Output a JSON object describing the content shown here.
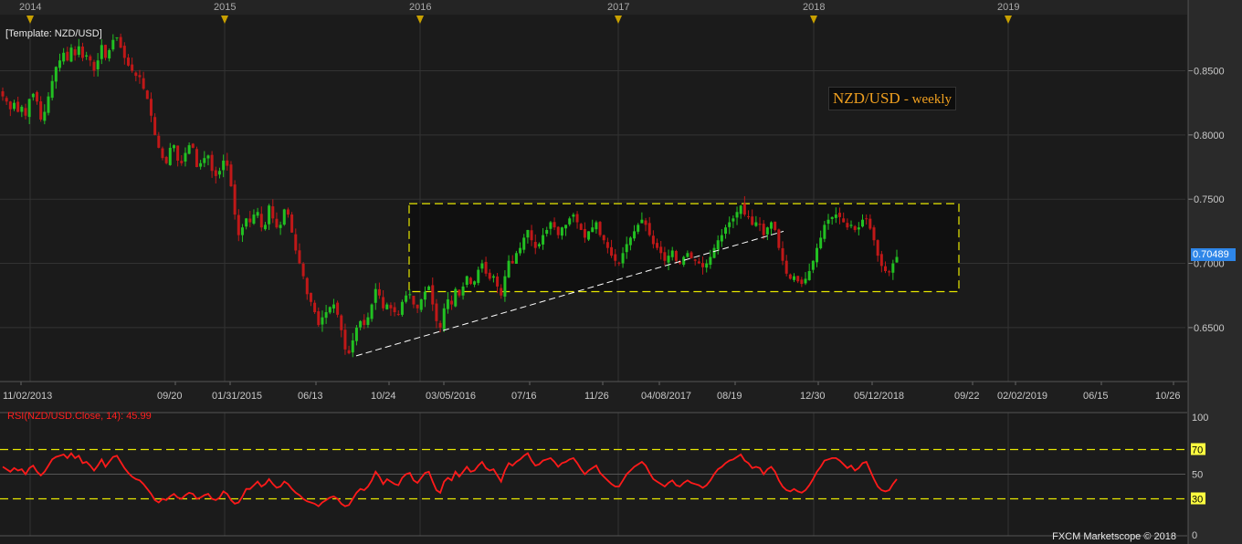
{
  "chart_data": {
    "type": "candlestick",
    "instrument_label": "[Template: NZD/USD]",
    "title": "NZD/USD",
    "subtitle": "- weekly",
    "current_price": "0.70489",
    "year_markers": [
      "2014",
      "2015",
      "2016",
      "2017",
      "2018",
      "2019"
    ],
    "x_tick_labels": [
      "11/02/2013",
      "09/20",
      "01/31/2015",
      "06/13",
      "10/24",
      "03/05/2016",
      "07/16",
      "11/26",
      "04/08/2017",
      "08/19",
      "12/30",
      "05/12/2018",
      "09/22",
      "02/02/2019",
      "06/15",
      "10/26"
    ],
    "y_tick_labels": [
      "0.8500",
      "0.8000",
      "0.7500",
      "0.7000",
      "0.6500"
    ],
    "ylim": [
      0.608,
      0.893
    ],
    "candle_closes": [
      0.83,
      0.826,
      0.82,
      0.825,
      0.818,
      0.822,
      0.815,
      0.828,
      0.832,
      0.826,
      0.812,
      0.818,
      0.83,
      0.842,
      0.853,
      0.858,
      0.864,
      0.858,
      0.868,
      0.862,
      0.869,
      0.86,
      0.862,
      0.858,
      0.85,
      0.858,
      0.87,
      0.86,
      0.866,
      0.874,
      0.876,
      0.868,
      0.86,
      0.854,
      0.85,
      0.846,
      0.845,
      0.836,
      0.828,
      0.815,
      0.8,
      0.79,
      0.782,
      0.778,
      0.79,
      0.792,
      0.78,
      0.778,
      0.786,
      0.792,
      0.79,
      0.775,
      0.778,
      0.782,
      0.784,
      0.772,
      0.768,
      0.772,
      0.78,
      0.776,
      0.76,
      0.738,
      0.722,
      0.728,
      0.735,
      0.732,
      0.738,
      0.74,
      0.728,
      0.73,
      0.745,
      0.735,
      0.728,
      0.73,
      0.742,
      0.738,
      0.724,
      0.71,
      0.7,
      0.69,
      0.676,
      0.67,
      0.662,
      0.652,
      0.658,
      0.662,
      0.666,
      0.668,
      0.66,
      0.648,
      0.633,
      0.63,
      0.64,
      0.65,
      0.655,
      0.652,
      0.658,
      0.668,
      0.68,
      0.675,
      0.665,
      0.668,
      0.665,
      0.662,
      0.66,
      0.67,
      0.675,
      0.676,
      0.668,
      0.665,
      0.672,
      0.678,
      0.682,
      0.668,
      0.655,
      0.65,
      0.665,
      0.672,
      0.668,
      0.68,
      0.675,
      0.682,
      0.69,
      0.684,
      0.686,
      0.695,
      0.7,
      0.692,
      0.688,
      0.69,
      0.682,
      0.675,
      0.69,
      0.702,
      0.7,
      0.708,
      0.712,
      0.72,
      0.726,
      0.718,
      0.712,
      0.715,
      0.722,
      0.726,
      0.732,
      0.728,
      0.722,
      0.728,
      0.73,
      0.735,
      0.738,
      0.732,
      0.726,
      0.72,
      0.725,
      0.728,
      0.732,
      0.722,
      0.718,
      0.712,
      0.706,
      0.702,
      0.7,
      0.708,
      0.715,
      0.72,
      0.725,
      0.73,
      0.734,
      0.73,
      0.722,
      0.715,
      0.712,
      0.708,
      0.702,
      0.706,
      0.71,
      0.702,
      0.7,
      0.705,
      0.708,
      0.704,
      0.702,
      0.7,
      0.697,
      0.7,
      0.705,
      0.712,
      0.718,
      0.722,
      0.728,
      0.732,
      0.735,
      0.74,
      0.745,
      0.738,
      0.736,
      0.73,
      0.732,
      0.73,
      0.722,
      0.728,
      0.732,
      0.726,
      0.712,
      0.702,
      0.692,
      0.688,
      0.69,
      0.686,
      0.684,
      0.688,
      0.694,
      0.702,
      0.712,
      0.72,
      0.73,
      0.734,
      0.736,
      0.738,
      0.736,
      0.732,
      0.728,
      0.73,
      0.726,
      0.728,
      0.734,
      0.735,
      0.727,
      0.718,
      0.706,
      0.698,
      0.694,
      0.693,
      0.7,
      0.705
    ],
    "range_box": {
      "top": 0.7465,
      "bottom": 0.678
    },
    "trendline": {
      "start": 0.628,
      "end": 0.725
    },
    "rsi": {
      "label": "RSI(NZD/USD.Close, 14): 45.99",
      "value": 45.99,
      "ylim": [
        0,
        100
      ],
      "levels": [
        70,
        30
      ],
      "axis_labels": [
        "100",
        "70",
        "50",
        "30",
        "0"
      ],
      "values": [
        56,
        54,
        52,
        55,
        53,
        54,
        50,
        55,
        57,
        52,
        49,
        52,
        57,
        62,
        64,
        65,
        66,
        63,
        67,
        63,
        65,
        59,
        60,
        57,
        53,
        57,
        62,
        56,
        60,
        64,
        65,
        60,
        55,
        51,
        48,
        46,
        45,
        42,
        38,
        34,
        29,
        27,
        30,
        29,
        32,
        34,
        31,
        30,
        33,
        35,
        34,
        30,
        31,
        33,
        34,
        30,
        29,
        31,
        36,
        34,
        29,
        26,
        27,
        32,
        38,
        38,
        41,
        44,
        40,
        42,
        46,
        42,
        39,
        40,
        44,
        42,
        38,
        35,
        33,
        30,
        28,
        27,
        26,
        24,
        27,
        29,
        31,
        32,
        30,
        26,
        24,
        25,
        30,
        35,
        38,
        37,
        40,
        45,
        52,
        48,
        42,
        46,
        44,
        42,
        41,
        47,
        50,
        51,
        45,
        43,
        47,
        51,
        52,
        44,
        37,
        35,
        44,
        47,
        45,
        52,
        48,
        52,
        56,
        52,
        53,
        57,
        60,
        55,
        53,
        54,
        49,
        44,
        53,
        59,
        57,
        60,
        62,
        65,
        67,
        61,
        57,
        58,
        61,
        62,
        63,
        60,
        56,
        59,
        60,
        62,
        63,
        59,
        54,
        50,
        53,
        55,
        57,
        51,
        48,
        45,
        42,
        40,
        40,
        45,
        50,
        53,
        56,
        58,
        60,
        57,
        51,
        46,
        44,
        42,
        40,
        43,
        45,
        41,
        40,
        43,
        45,
        43,
        42,
        41,
        39,
        41,
        45,
        50,
        54,
        56,
        59,
        61,
        62,
        64,
        66,
        61,
        59,
        55,
        56,
        55,
        50,
        54,
        56,
        52,
        45,
        40,
        37,
        36,
        38,
        36,
        35,
        37,
        41,
        46,
        52,
        56,
        61,
        62,
        63,
        63,
        61,
        58,
        55,
        57,
        53,
        55,
        59,
        60,
        53,
        46,
        40,
        37,
        36,
        37,
        42,
        46
      ]
    }
  },
  "ui": {
    "footer": "FXCM Marketscope © 2018"
  }
}
